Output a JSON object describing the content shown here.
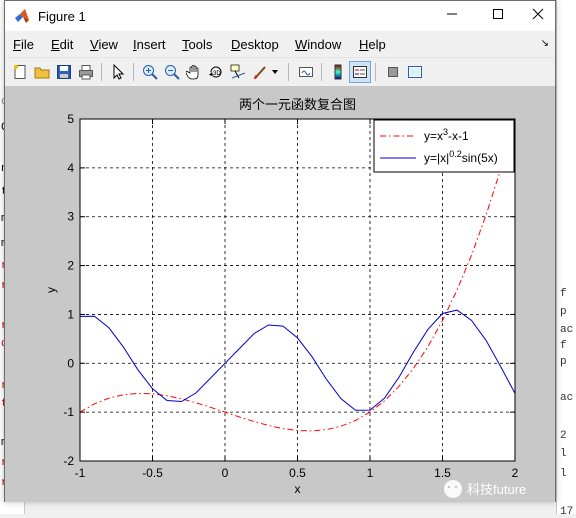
{
  "window": {
    "title": "Figure 1"
  },
  "menu": {
    "file": "File",
    "edit": "Edit",
    "view": "View",
    "insert": "Insert",
    "tools": "Tools",
    "desktop": "Desktop",
    "window": "Window",
    "help": "Help"
  },
  "toolbar": {
    "icons": [
      "new-figure-icon",
      "open-file-icon",
      "save-icon",
      "print-icon",
      "edit-plot-icon",
      "zoom-in-icon",
      "zoom-out-icon",
      "pan-icon",
      "rotate-3d-icon",
      "data-cursor-icon",
      "brush-icon",
      "link-plot-icon",
      "colorbar-icon",
      "legend-icon",
      "hide-plot-tools-icon",
      "show-plot-tools-icon"
    ]
  },
  "watermark": {
    "text": "科技future"
  },
  "background": {
    "left_marks": [
      "ow",
      "C",
      "no",
      "t",
      "m",
      "m",
      "r",
      "r",
      "r",
      "o",
      "r",
      "t",
      "m",
      "r",
      "r"
    ],
    "right_marks": [
      "f",
      "p",
      "ac",
      "f",
      "p",
      "ac",
      "2",
      "l",
      "l",
      "17"
    ]
  },
  "chart_data": {
    "type": "line",
    "title": "两个一元函数复合图",
    "xlabel": "x",
    "ylabel": "y",
    "xlim": [
      -1,
      2
    ],
    "ylim": [
      -2,
      5
    ],
    "xticks": [
      "-1",
      "-0.5",
      "0",
      "0.5",
      "1",
      "1.5",
      "2"
    ],
    "yticks": [
      "-2",
      "-1",
      "0",
      "1",
      "2",
      "3",
      "4",
      "5"
    ],
    "grid": true,
    "legend_position": "top-right",
    "series": [
      {
        "name": "y=x³-x-1",
        "legend_main": "y=x",
        "legend_sup": "3",
        "legend_tail": "-x-1",
        "color": "#ff0000",
        "style": "dash-dot",
        "x": [
          -1,
          -0.9,
          -0.8,
          -0.7,
          -0.6,
          -0.5,
          -0.4,
          -0.3,
          -0.2,
          -0.1,
          0,
          0.1,
          0.2,
          0.3,
          0.4,
          0.5,
          0.6,
          0.7,
          0.8,
          0.9,
          1,
          1.1,
          1.2,
          1.3,
          1.4,
          1.5,
          1.6,
          1.7,
          1.8,
          1.9,
          2
        ],
        "y": [
          -1,
          -0.829,
          -0.712,
          -0.643,
          -0.616,
          -0.625,
          -0.664,
          -0.727,
          -0.808,
          -0.901,
          -1,
          -1.099,
          -1.192,
          -1.273,
          -1.336,
          -1.375,
          -1.384,
          -1.357,
          -1.288,
          -1.171,
          -1,
          -0.769,
          -0.472,
          -0.103,
          0.344,
          0.875,
          1.496,
          2.213,
          3.032,
          3.959,
          5
        ]
      },
      {
        "name": "y=|x|^0.2 sin(5x)",
        "legend_main": "y=|x|",
        "legend_sup": "0.2",
        "legend_tail": "sin(5x)",
        "color": "#0000cc",
        "style": "solid",
        "x": [
          -1,
          -0.9,
          -0.8,
          -0.7,
          -0.6,
          -0.5,
          -0.4,
          -0.3,
          -0.2,
          -0.1,
          0,
          0.1,
          0.2,
          0.3,
          0.4,
          0.5,
          0.6,
          0.7,
          0.8,
          0.9,
          1,
          1.1,
          1.2,
          1.3,
          1.4,
          1.5,
          1.6,
          1.7,
          1.8,
          1.9,
          2
        ],
        "y": [
          0.959,
          0.963,
          0.725,
          0.329,
          -0.135,
          -0.52,
          -0.761,
          -0.783,
          -0.607,
          -0.303,
          0,
          0.303,
          0.607,
          0.783,
          0.761,
          0.52,
          0.135,
          -0.329,
          -0.725,
          -0.963,
          -0.959,
          -0.715,
          -0.285,
          0.23,
          0.696,
          1.02,
          1.089,
          0.88,
          0.47,
          -0.06,
          -0.617
        ]
      }
    ]
  }
}
